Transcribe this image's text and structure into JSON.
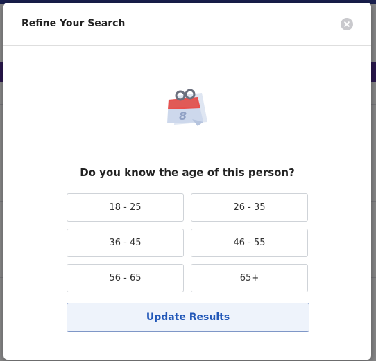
{
  "modal": {
    "title": "Refine Your Search",
    "question": "Do you know the age of this person?",
    "age_options": [
      "18 - 25",
      "26 - 35",
      "36 - 45",
      "46 - 55",
      "56 - 65",
      "65+"
    ],
    "update_label": "Update Results",
    "calendar_day": "8"
  },
  "icons": {
    "close": "close-icon",
    "calendar": "calendar-icon"
  },
  "colors": {
    "accent": "#2157b8",
    "calendar_red": "#e8504d"
  }
}
